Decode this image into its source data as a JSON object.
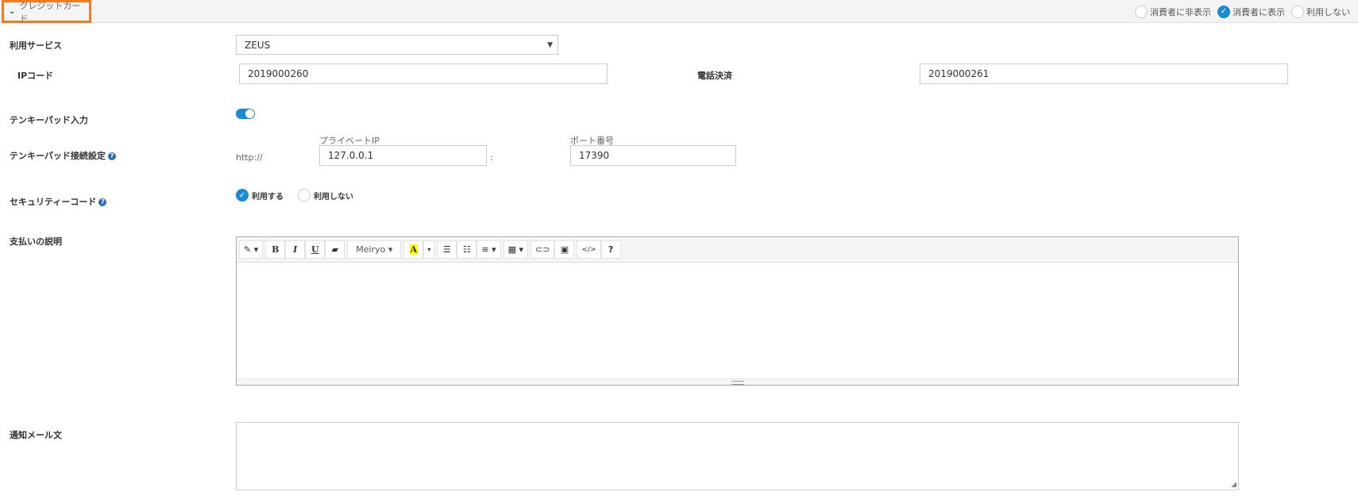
{
  "header": {
    "title": "クレジットカード",
    "visibility_options": [
      {
        "label": "消費者に非表示",
        "checked": false
      },
      {
        "label": "消費者に表示",
        "checked": true
      },
      {
        "label": "利用しない",
        "checked": false
      }
    ]
  },
  "service": {
    "label": "利用サービス",
    "value": "ZEUS"
  },
  "ip_code": {
    "label": "IPコード",
    "value": "2019000260"
  },
  "phone": {
    "label": "電話決済",
    "value": "2019000261"
  },
  "tenkey_input": {
    "label": "テンキーパッド入力",
    "enabled": true
  },
  "tenkey_conn": {
    "label": "テンキーパッド接続設定",
    "prefix": "http://",
    "ip_label": "プライベートIP",
    "ip_value": "127.0.0.1",
    "sep": ":",
    "port_label": "ポート番号",
    "port_value": "17390"
  },
  "security": {
    "label": "セキュリティーコード",
    "options": [
      {
        "label": "利用する",
        "checked": true
      },
      {
        "label": "利用しない",
        "checked": false
      }
    ]
  },
  "payment_desc": {
    "label": "支払いの説明",
    "toolbar": {
      "font": "Meiryo",
      "bold": "B",
      "italic": "I",
      "underline": "U",
      "color": "A",
      "code": "</>",
      "help": "?"
    }
  },
  "notify_mail": {
    "label": "通知メール文"
  },
  "colors": {
    "accent": "#1a8ad4",
    "highlight": "#f47b20"
  }
}
